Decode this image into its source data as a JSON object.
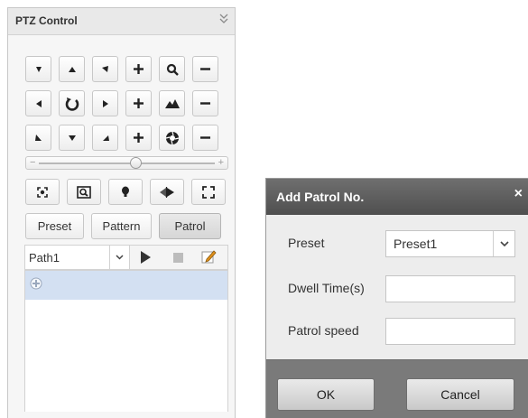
{
  "ptz_panel": {
    "title": "PTZ Control",
    "icons": {
      "collapse": "double-chevron-down-icon"
    },
    "direction_rows": [
      [
        {
          "name": "pan-down-left-icon",
          "glyph": "tri-down-right"
        },
        {
          "name": "tilt-up-icon",
          "glyph": "tri-up"
        },
        {
          "name": "pan-up-right-icon",
          "glyph": "tri-down-left"
        },
        {
          "name": "zoom-in-icon",
          "glyph": "plus"
        },
        {
          "name": "zoom-magnifier-icon",
          "glyph": "magnifier"
        },
        {
          "name": "zoom-out-icon",
          "glyph": "minus"
        }
      ],
      [
        {
          "name": "pan-left-icon",
          "glyph": "tri-left"
        },
        {
          "name": "auto-pan-icon",
          "glyph": "refresh"
        },
        {
          "name": "pan-right-icon",
          "glyph": "tri-right"
        },
        {
          "name": "focus-near-icon",
          "glyph": "plus"
        },
        {
          "name": "focus-mountain-icon",
          "glyph": "mountain"
        },
        {
          "name": "focus-far-icon",
          "glyph": "minus"
        }
      ],
      [
        {
          "name": "pan-down-right-icon",
          "glyph": "tri-up-right"
        },
        {
          "name": "tilt-down-icon",
          "glyph": "tri-down"
        },
        {
          "name": "pan-down-left-2-icon",
          "glyph": "tri-up-left"
        },
        {
          "name": "iris-open-icon",
          "glyph": "plus"
        },
        {
          "name": "iris-aperture-icon",
          "glyph": "aperture"
        },
        {
          "name": "iris-close-icon",
          "glyph": "minus"
        }
      ]
    ],
    "speed": {
      "minus": "−",
      "plus": "+",
      "level": 0.55
    },
    "tools": [
      "light-icon",
      "zoom-area-icon",
      "focus-point-icon",
      "wiper-icon",
      "fullscreen-icon"
    ],
    "tabs": [
      {
        "label": "Preset",
        "active": false
      },
      {
        "label": "Pattern",
        "active": false
      },
      {
        "label": "Patrol",
        "active": true
      }
    ],
    "path": {
      "selected": "Path1"
    }
  },
  "dialog": {
    "title": "Add Patrol No.",
    "close": "×",
    "preset_label": "Preset",
    "preset_value": "Preset1",
    "dwell_label": "Dwell Time(s)",
    "dwell_value": "",
    "speed_label": "Patrol speed",
    "speed_value": "",
    "ok_label": "OK",
    "cancel_label": "Cancel"
  }
}
